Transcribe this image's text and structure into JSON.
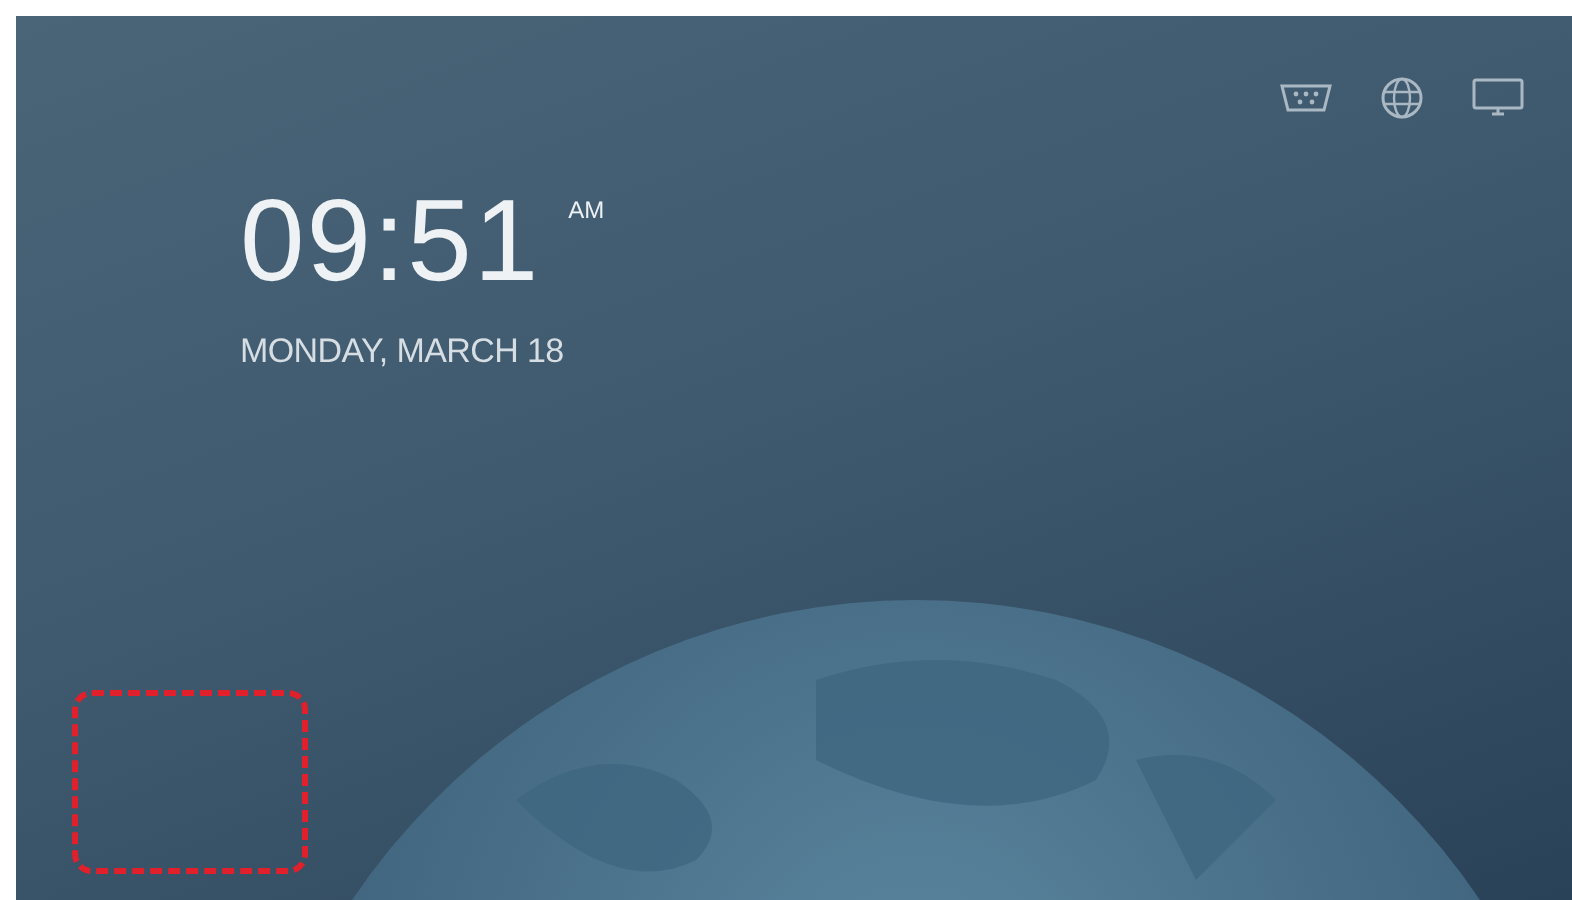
{
  "status_icons": [
    {
      "kind": "port"
    },
    {
      "kind": "globe"
    },
    {
      "kind": "monitor"
    }
  ],
  "clock": {
    "time": "09:51",
    "meridiem": "AM",
    "date": "MONDAY, MARCH 18"
  }
}
